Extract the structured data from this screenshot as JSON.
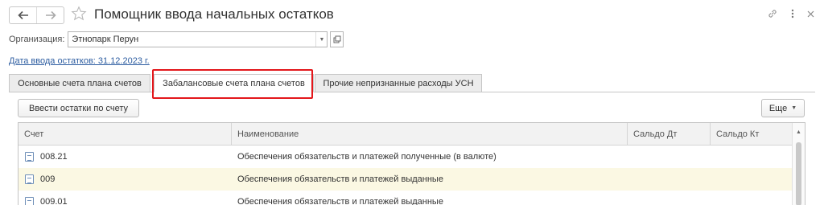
{
  "window": {
    "title": "Помощник ввода начальных остатков",
    "nav": {
      "back_icon": "arrow-left",
      "forward_icon": "arrow-right"
    },
    "icons": [
      "link-icon",
      "more-vertical-icon",
      "close-icon"
    ]
  },
  "form": {
    "org_label": "Организация:",
    "org_value": "Этнопарк Перун",
    "date_link": "Дата ввода остатков: 31.12.2023 г."
  },
  "tabs": [
    {
      "label": "Основные счета плана счетов",
      "active": false
    },
    {
      "label": "Забалансовые счета плана счетов",
      "active": true
    },
    {
      "label": "Прочие непризнанные расходы УСН",
      "active": false
    }
  ],
  "toolbar": {
    "enter_button": "Ввести остатки по счету",
    "more_button": "Еще"
  },
  "table": {
    "columns": [
      "Счет",
      "Наименование",
      "Сальдо Дт",
      "Сальдо Кт"
    ],
    "rows": [
      {
        "account": "008.21",
        "name": "Обеспечения обязательств и платежей полученные (в валюте)",
        "debit": "",
        "credit": "",
        "selected": false
      },
      {
        "account": "009",
        "name": "Обеспечения обязательств и платежей выданные",
        "debit": "",
        "credit": "",
        "selected": true
      },
      {
        "account": "009.01",
        "name": "Обеспечения обязательств и платежей выданные",
        "debit": "",
        "credit": "",
        "selected": false
      }
    ]
  },
  "colors": {
    "link": "#2d5da1",
    "highlight_border": "#e3171b",
    "selected_row": "#fbf8e3"
  }
}
